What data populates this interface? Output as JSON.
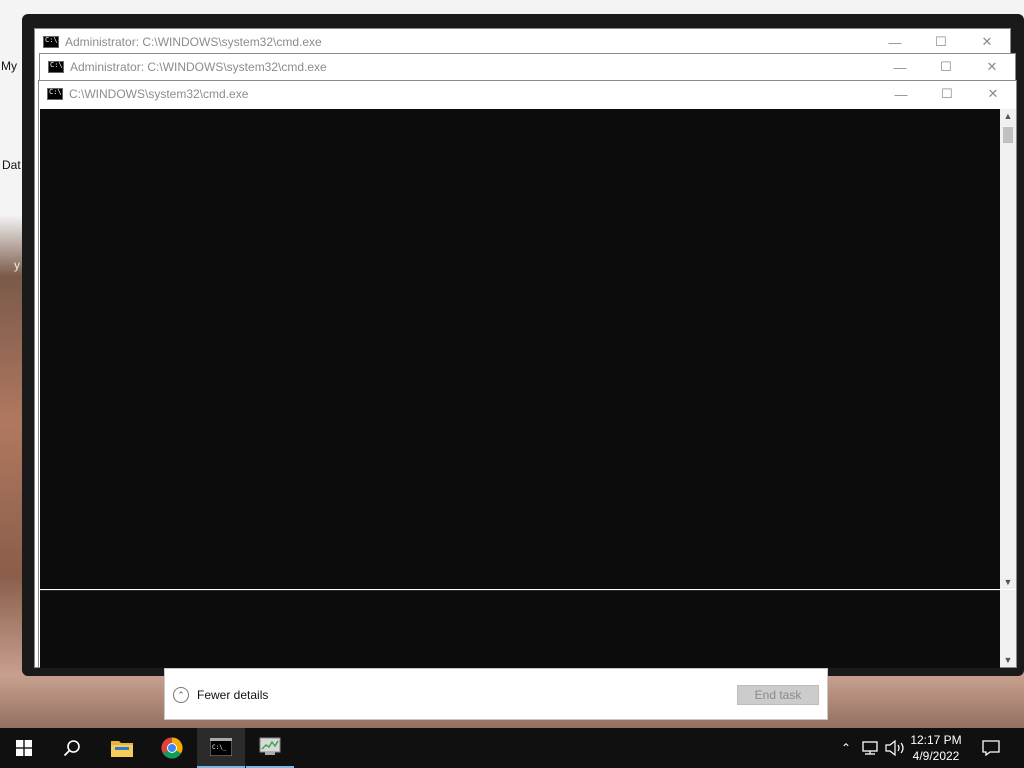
{
  "desktop": {
    "fragments": [
      "My",
      "Dat",
      "y"
    ]
  },
  "windows": [
    {
      "title": "Administrator: C:\\WINDOWS\\system32\\cmd.exe"
    },
    {
      "title": "Administrator: C:\\WINDOWS\\system32\\cmd.exe"
    },
    {
      "title": "C:\\WINDOWS\\system32\\cmd.exe"
    }
  ],
  "window_controls": {
    "minimize": "—",
    "maximize": "☐",
    "close": "✕"
  },
  "task_manager": {
    "fewer_details": "Fewer details",
    "end_task": "End task"
  },
  "taskbar": {
    "icons": [
      "windows-start-icon",
      "search-icon",
      "file-explorer-icon",
      "chrome-icon",
      "cmd-icon",
      "task-manager-icon"
    ],
    "time": "12:17 PM",
    "date": "4/9/2022",
    "tray_icons": [
      "chevron-up-icon",
      "network-icon",
      "volume-icon",
      "notification-icon"
    ]
  }
}
